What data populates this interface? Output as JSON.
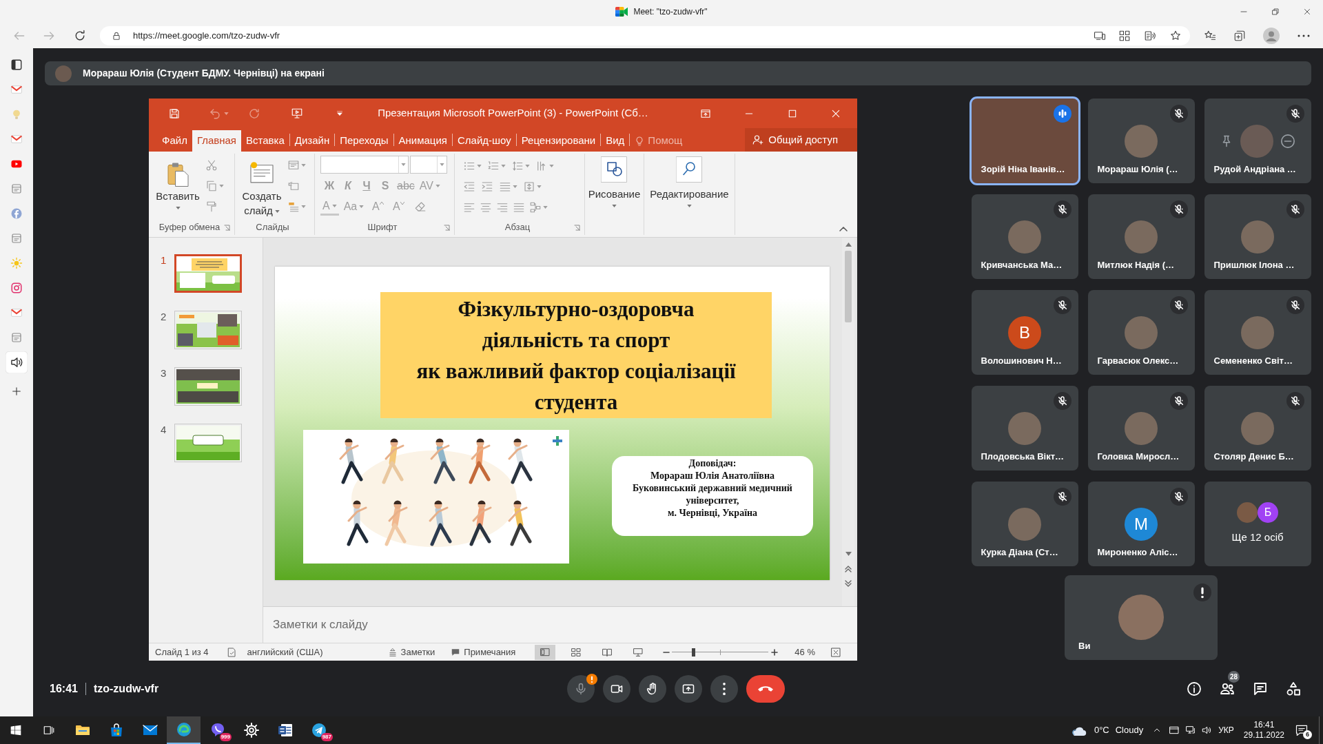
{
  "browser": {
    "title": "Meet: \"tzo-zudw-vfr\"",
    "url": "https://meet.google.com/tzo-zudw-vfr"
  },
  "sidebar": {
    "items": [
      {
        "kind": "tabs",
        "selected": false
      },
      {
        "kind": "mail",
        "selected": false
      },
      {
        "kind": "bulb",
        "selected": false
      },
      {
        "kind": "mail",
        "selected": false
      },
      {
        "kind": "video",
        "selected": false
      },
      {
        "kind": "page",
        "selected": false
      },
      {
        "kind": "social",
        "selected": false
      },
      {
        "kind": "page",
        "selected": false
      },
      {
        "kind": "sun",
        "selected": false
      },
      {
        "kind": "camera",
        "selected": false
      },
      {
        "kind": "mail",
        "selected": false
      },
      {
        "kind": "page",
        "selected": false
      },
      {
        "kind": "speaker",
        "selected": true
      }
    ]
  },
  "meet": {
    "banner": "Морараш Юлія (Студент БДМУ. Чернівці) на екрані",
    "powerpoint": {
      "title": "Презентация Microsoft PowerPoint (3) - PowerPoint (Сб…",
      "tabs": [
        {
          "label": "Файл",
          "selected": false
        },
        {
          "label": "Главная",
          "selected": true
        },
        {
          "label": "Вставка",
          "selected": false
        },
        {
          "label": "Дизайн",
          "selected": false
        },
        {
          "label": "Переходы",
          "selected": false
        },
        {
          "label": "Анимация",
          "selected": false
        },
        {
          "label": "Слайд-шоу",
          "selected": false
        },
        {
          "label": "Рецензировани",
          "selected": false
        },
        {
          "label": "Вид",
          "selected": false
        }
      ],
      "tell_me": "Помощ",
      "share": "Общий доступ",
      "ribbon": {
        "paste": "Вставить",
        "clipboard": "Буфер обмена",
        "new_slide": "Создать слайд",
        "slides": "Слайды",
        "font_row_1": [
          {
            "text": "Ж",
            "kind": "bold"
          },
          {
            "text": "К",
            "kind": "italic"
          },
          {
            "text": "Ч",
            "kind": "underline"
          },
          {
            "text": "S",
            "kind": "shadow"
          },
          {
            "text": "abc",
            "kind": "strike"
          },
          {
            "text": "AV",
            "kind": "spacing"
          }
        ],
        "font_row_2": [
          {
            "text": "A",
            "kind": "color"
          },
          {
            "text": "Aa",
            "kind": "case"
          },
          {
            "text": "A",
            "kind": "grow"
          },
          {
            "text": "A",
            "kind": "shrink"
          }
        ],
        "font": "Шрифт",
        "paragraph": "Абзац",
        "drawing": "Рисование",
        "editing": "Редактирование"
      },
      "thumbnails": [
        {
          "number": "1",
          "kind": "title",
          "selected": true
        },
        {
          "number": "2",
          "kind": "collage",
          "selected": false
        },
        {
          "number": "3",
          "kind": "gallery",
          "selected": false
        },
        {
          "number": "4",
          "kind": "closing",
          "selected": false
        }
      ],
      "slide": {
        "title": "Фізкультурно-оздоровча\nдіяльність та спорт\nяк важливий фактор соціалізації\nстудента",
        "speaker": "Доповідач:\nМорараш Юлія Анатоліївна\nБуковинський державний медичний\nуніверситет,\nм. Чернівці, Україна"
      },
      "notes_placeholder": "Заметки к слайду",
      "status": {
        "slide": "Слайд 1 из 4",
        "language": "английский (США)",
        "notes": "Заметки",
        "comments": "Примечания",
        "views": [
          {
            "kind": "normal",
            "selected": true
          },
          {
            "kind": "sorter",
            "selected": false
          },
          {
            "kind": "reading",
            "selected": false
          },
          {
            "kind": "slideshow",
            "selected": false
          }
        ],
        "zoom_slider": {
          "level": 0.22
        },
        "zoom": "46 %"
      }
    },
    "tiles": [
      {
        "name": "Зорій Ніна Іванів…",
        "kind": "video",
        "speaking": true,
        "muted": false,
        "hovered": false
      },
      {
        "name": "Морараш Юлія (…",
        "kind": "photo",
        "speaking": false,
        "muted": true,
        "hovered": false
      },
      {
        "name": "Рудой Андріана …",
        "kind": "photo",
        "speaking": false,
        "muted": true,
        "hovered": true
      },
      {
        "name": "Кривчанська Ма…",
        "kind": "photo",
        "speaking": false,
        "muted": true,
        "hovered": false
      },
      {
        "name": "Митлюк Надія (…",
        "kind": "photo",
        "speaking": false,
        "muted": true,
        "hovered": false
      },
      {
        "name": "Пришлюк Ілона …",
        "kind": "photo",
        "speaking": false,
        "muted": true,
        "hovered": false
      },
      {
        "name": "Волошинович Н…",
        "kind": "letter",
        "initial": "В",
        "color": "#cc4a1b",
        "speaking": false,
        "muted": true,
        "hovered": false
      },
      {
        "name": "Гарвасюк Олекс…",
        "kind": "photo",
        "speaking": false,
        "muted": true,
        "hovered": false
      },
      {
        "name": "Семененко Світ…",
        "kind": "photo",
        "speaking": false,
        "muted": true,
        "hovered": false
      },
      {
        "name": "Плодовська Вікт…",
        "kind": "photo",
        "speaking": false,
        "muted": true,
        "hovered": false
      },
      {
        "name": "Головка Миросл…",
        "kind": "photo",
        "speaking": false,
        "muted": true,
        "hovered": false
      },
      {
        "name": "Столяр Денис Б…",
        "kind": "photo",
        "speaking": false,
        "muted": true,
        "hovered": false
      },
      {
        "name": "Курка Діана (Ст…",
        "kind": "photo",
        "speaking": false,
        "muted": true,
        "hovered": false
      },
      {
        "name": "Мироненко Аліс…",
        "kind": "letter",
        "initial": "М",
        "color": "#1e88d6",
        "speaking": false,
        "muted": true,
        "hovered": false
      }
    ],
    "more": {
      "label": "Ще 12 осіб",
      "initial": "Б",
      "color": "#a142f4"
    },
    "self": {
      "name": "Ви",
      "warning": true
    },
    "time": "16:41",
    "meeting_code": "tzo-zudw-vfr",
    "controls": [
      {
        "kind": "mic",
        "disabled": true,
        "warning": true
      },
      {
        "kind": "camera",
        "disabled": false,
        "warning": false
      },
      {
        "kind": "hand",
        "disabled": false,
        "warning": false
      },
      {
        "kind": "present",
        "disabled": false,
        "warning": false
      },
      {
        "kind": "more",
        "disabled": false,
        "warning": false
      },
      {
        "kind": "end",
        "disabled": false,
        "warning": false
      }
    ],
    "side_controls": [
      {
        "kind": "info"
      },
      {
        "kind": "people",
        "badge": "28"
      },
      {
        "kind": "chat"
      },
      {
        "kind": "activities"
      }
    ]
  },
  "taskbar": {
    "apps": [
      {
        "kind": "explorer",
        "active": false
      },
      {
        "kind": "store",
        "active": false
      },
      {
        "kind": "mail",
        "active": false
      },
      {
        "kind": "edge",
        "active": true
      },
      {
        "kind": "viber",
        "active": false,
        "badge": "999"
      },
      {
        "kind": "settings",
        "active": false
      },
      {
        "kind": "word",
        "active": false
      },
      {
        "kind": "telegram",
        "active": false,
        "badge": "987"
      }
    ],
    "weather": {
      "temp": "0°C",
      "condition": "Cloudy"
    },
    "language": "УКР",
    "time": "16:41",
    "date": "29.11.2022",
    "notifications": "6"
  }
}
